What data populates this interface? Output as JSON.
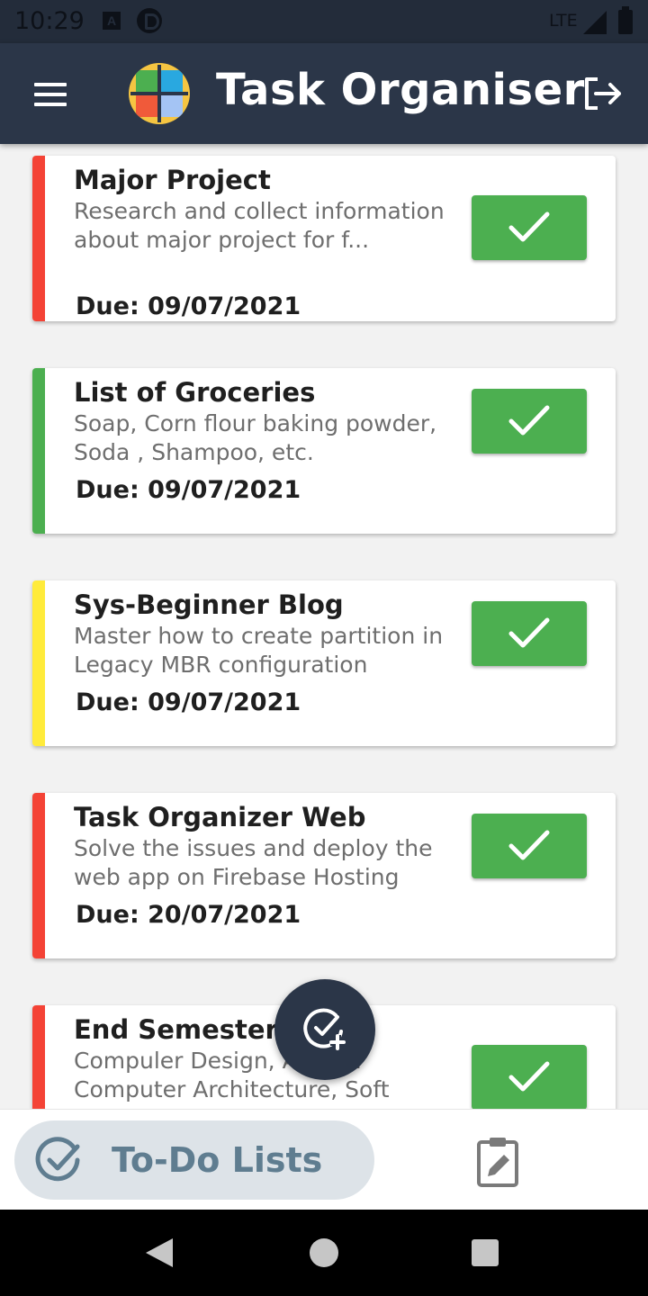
{
  "status_bar": {
    "time": "10:29",
    "a_icon_label": "A",
    "network": "LTE",
    "icons": [
      "a-notification-icon",
      "p-notification-icon",
      "signal-icon",
      "battery-icon"
    ]
  },
  "app_bar": {
    "title": "Task Organiser",
    "menu_icon": "hamburger-menu-icon",
    "logout_icon": "logout-icon",
    "logo": "task-organiser-logo"
  },
  "colors": {
    "app_bar": "#2b3648",
    "status_bar": "#232c3a",
    "check_button": "#4caf50",
    "priority_high": "#f44336",
    "priority_low": "#4caf50",
    "priority_medium": "#ffeb3b",
    "nav_active_bg": "#dde3e8",
    "nav_active_text": "#5f7d90"
  },
  "tasks": [
    {
      "title": "Major Project",
      "description": "Research and collect information about major project for f...",
      "due": "Due: 09/07/2021",
      "priority_color": "#f44336"
    },
    {
      "title": "List of Groceries",
      "description": "Soap, Corn flour baking powder, Soda , Shampoo, etc.",
      "due": "Due: 09/07/2021",
      "priority_color": "#4caf50"
    },
    {
      "title": "Sys-Beginner Blog",
      "description": "Master how to create partition in Legacy MBR configuration",
      "due": "Due: 09/07/2021",
      "priority_color": "#ffeb3b"
    },
    {
      "title": "Task Organizer Web",
      "description": "Solve the issues and deploy the web app on Firebase Hosting",
      "due": "Due: 20/07/2021",
      "priority_color": "#f44336"
    },
    {
      "title": "End Semester E",
      "description": "Compuler Design, A     ed Computer Architecture, Soft",
      "due": "",
      "priority_color": "#f44336"
    }
  ],
  "fab": {
    "icon": "add-task-icon"
  },
  "bottom_nav": {
    "active_label": "To-Do Lists",
    "active_icon": "check-circle-icon",
    "other_icon": "clipboard-edit-icon"
  },
  "system_nav": [
    "back-icon",
    "home-icon",
    "recents-icon"
  ]
}
